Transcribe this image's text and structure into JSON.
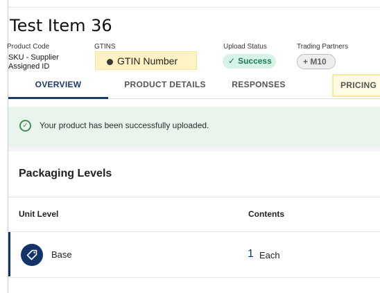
{
  "header": {
    "title": "Test Item 36",
    "product_code_label": "Product Code",
    "product_code_value": "SKU - Supplier Assigned ID",
    "gtins_label": "GTINS",
    "gtin_value": "GTIN Number",
    "upload_status_label": "Upload Status",
    "upload_status_value": "Success",
    "trading_partners_label": "Trading Partners",
    "trading_partner_value": "M10"
  },
  "tabs": [
    {
      "label": "OVERVIEW",
      "active": true
    },
    {
      "label": "PRODUCT DETAILS",
      "active": false
    },
    {
      "label": "RESPONSES",
      "active": false
    },
    {
      "label": "PRICING",
      "active": false
    }
  ],
  "alert": {
    "message": "Your product has been successfully uploaded."
  },
  "packaging": {
    "title": "Packaging Levels",
    "columns": [
      "Unit Level",
      "Contents"
    ],
    "rows": [
      {
        "unit_level": "Base",
        "quantity": "1",
        "unit": "Each"
      }
    ]
  },
  "colors": {
    "primary": "#14336b",
    "success_bg": "#d6f3e8",
    "success_text": "#1b7a52",
    "highlight": "#fff3c4",
    "alert_bg": "#e9f5ec"
  }
}
